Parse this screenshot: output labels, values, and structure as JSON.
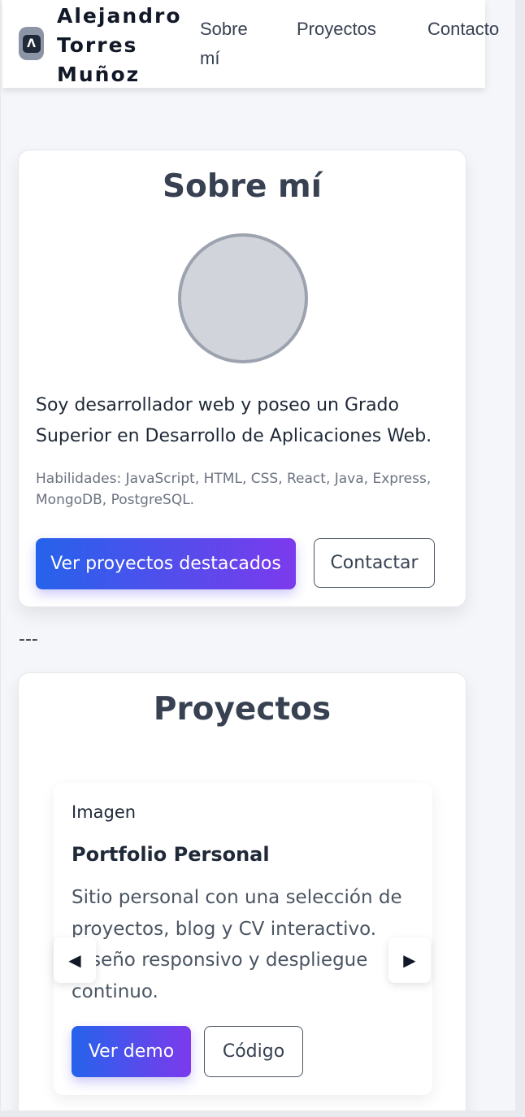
{
  "header": {
    "logo_glyph": "Λ",
    "brand_name": "Alejandro Torres Muñoz",
    "nav": [
      {
        "label": "Sobre mí"
      },
      {
        "label": "Proyectos"
      },
      {
        "label": "Contacto"
      }
    ]
  },
  "about": {
    "title": "Sobre mí",
    "description": "Soy desarrollador web y poseo un Grado Superior en Desarrollo de Aplicaciones Web.",
    "skills": "Habilidades: JavaScript, HTML, CSS, React, Java, Express, MongoDB, PostgreSQL.",
    "primary_button": "Ver proyectos destacados",
    "secondary_button": "Contactar"
  },
  "divider": "---",
  "projects": {
    "title": "Proyectos",
    "slide": {
      "image_label": "Imagen",
      "title": "Portfolio Personal",
      "description": "Sitio personal con una selección de proyectos, blog y CV interactivo. Diseño responsivo y despliegue continuo.",
      "demo_button": "Ver demo",
      "code_button": "Código"
    },
    "prev_arrow": "◀",
    "next_arrow": "▶"
  },
  "colors": {
    "accent_gradient_start": "#2563eb",
    "accent_gradient_end": "#7c3aed",
    "page_background": "#f4f6fa"
  }
}
